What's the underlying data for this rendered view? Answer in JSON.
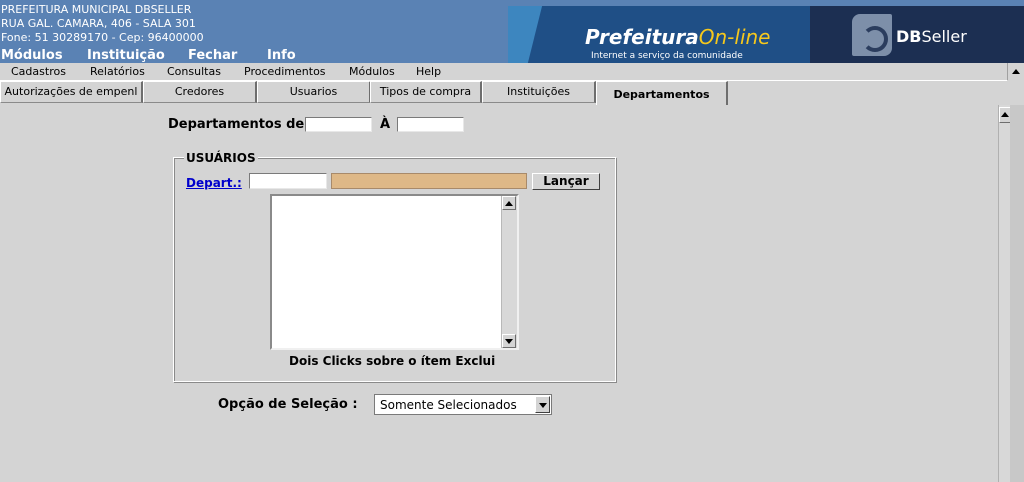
{
  "header": {
    "line1": "PREFEITURA MUNICIPAL DBSELLER",
    "line2": "RUA GAL. CAMARA, 406 - SALA 301",
    "line3": "Fone: 51 30289170  -  Cep: 96400000",
    "top_menu": [
      "Módulos",
      "Instituição",
      "Fechar",
      "Info"
    ]
  },
  "banner": {
    "pref_title": "Prefeitura",
    "pref_online": "On-line",
    "pref_sub": "Internet a serviço da comunidade",
    "dbseller_bold": "DB",
    "dbseller_light": "Seller"
  },
  "menubar": [
    "Cadastros",
    "Relatórios",
    "Consultas",
    "Procedimentos",
    "Módulos",
    "Help"
  ],
  "tabs": [
    {
      "label": "Autorizações de empenl",
      "active": false
    },
    {
      "label": "Credores",
      "active": false
    },
    {
      "label": "Usuarios",
      "active": false
    },
    {
      "label": "Tipos de compra",
      "active": false
    },
    {
      "label": "Instituições",
      "active": false
    },
    {
      "label": "Departamentos",
      "active": true
    }
  ],
  "form": {
    "range_label": "Departamentos de",
    "range_to": "À",
    "range_from_value": "",
    "range_to_value": "",
    "fieldset_legend": "USUÁRIOS",
    "depart_label": "Depart.:",
    "depart_code": "",
    "depart_desc": "",
    "lancar_label": "Lançar",
    "list_hint": "Dois Clicks sobre o ítem Exclui",
    "option_label": "Opção de Seleção :",
    "option_value": "Somente Selecionados"
  },
  "colors": {
    "header_bg": "#5a82b4",
    "face": "#d4d4d4",
    "desc_field": "#deb887",
    "link": "#0000cc"
  }
}
